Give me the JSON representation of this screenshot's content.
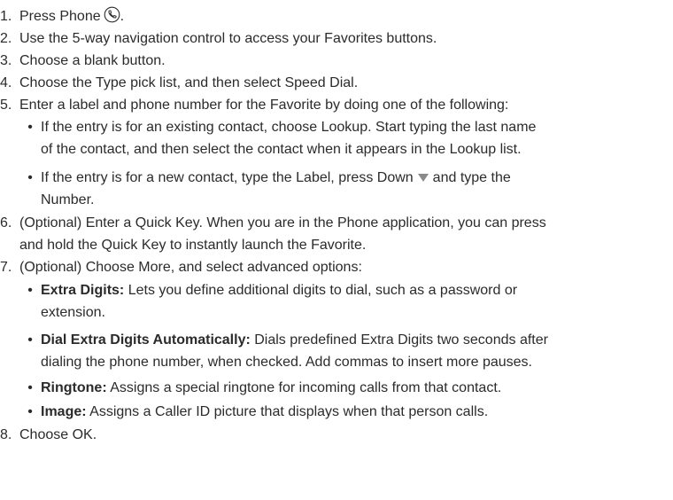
{
  "steps": [
    {
      "num": "1.",
      "text": "Press Phone",
      "icon": "phone-icon",
      "suffix": "."
    },
    {
      "num": "2.",
      "text": "Use the 5-way navigation control to access your Favorites buttons."
    },
    {
      "num": "3.",
      "text": "Choose a blank button."
    },
    {
      "num": "4.",
      "text": "Choose the Type pick list, and then select Speed Dial."
    },
    {
      "num": "5.",
      "text": "Enter a label and phone number for the Favorite by doing one of the following:"
    },
    {
      "num": "6.",
      "line1": "(Optional) Enter a Quick Key. When you are in the Phone application, you can press",
      "line2": "and hold the Quick Key to instantly launch the Favorite."
    },
    {
      "num": "7.",
      "text": "(Optional) Choose More, and select advanced options:"
    },
    {
      "num": "8.",
      "text": "Choose OK."
    }
  ],
  "step5_bullets": [
    {
      "line1": "If the entry is for an existing contact, choose Lookup. Start typing the last name",
      "line2": "of the contact, and then select the contact when it appears in the Lookup list."
    },
    {
      "line1a": "If the entry is for a new contact, type the Label, press Down",
      "icon": "down-arrow-icon",
      "line1b": "and type the",
      "line2": "Number."
    }
  ],
  "step7_bullets": [
    {
      "term": "Extra Digits:",
      "line1": " Lets you define additional digits to dial, such as a password or",
      "line2": "extension."
    },
    {
      "term": "Dial Extra Digits Automatically:",
      "line1": " Dials predefined Extra Digits two seconds after",
      "line2": "dialing the phone number, when checked. Add commas to insert more pauses."
    },
    {
      "term": "Ringtone:",
      "line1": " Assigns a special ringtone for incoming calls from that contact."
    },
    {
      "term": "Image:",
      "line1": " Assigns a Caller ID picture that displays when that person calls."
    }
  ],
  "bullet_glyph": "•",
  "colors": {
    "text": "#2b2b2b",
    "icon_gray": "#8a8a8a"
  }
}
